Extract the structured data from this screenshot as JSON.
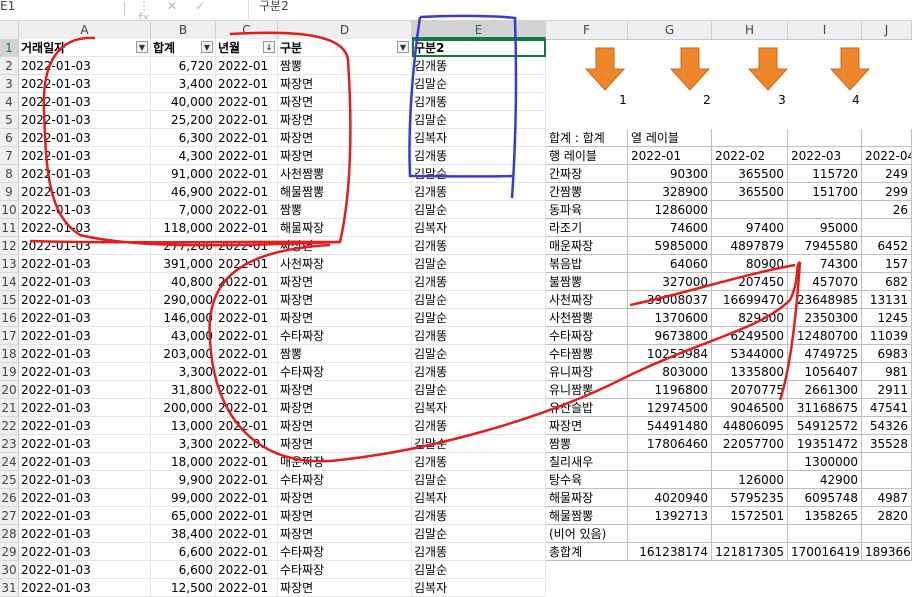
{
  "formula_bar": {
    "name_box": "E1",
    "buttons": [
      "⋮",
      "✕",
      "✓",
      "fx"
    ],
    "content": "구분2"
  },
  "columns": [
    "A",
    "B",
    "C",
    "D",
    "E",
    "F",
    "G",
    "H",
    "I",
    "J"
  ],
  "headers": {
    "a": "거래일자",
    "b": "합계",
    "c": "년월",
    "d": "구분",
    "e": "구분2"
  },
  "rows": [
    {
      "n": "2",
      "a": "2022-01-03",
      "b": "6,720",
      "c": "2022-01",
      "d": "짬뽕",
      "e": "김개똥"
    },
    {
      "n": "3",
      "a": "2022-01-03",
      "b": "3,400",
      "c": "2022-01",
      "d": "짜장면",
      "e": "김말순"
    },
    {
      "n": "4",
      "a": "2022-01-03",
      "b": "40,000",
      "c": "2022-01",
      "d": "짜장면",
      "e": "김개똥"
    },
    {
      "n": "5",
      "a": "2022-01-03",
      "b": "25,200",
      "c": "2022-01",
      "d": "짜장면",
      "e": "김말순"
    },
    {
      "n": "6",
      "a": "2022-01-03",
      "b": "6,300",
      "c": "2022-01",
      "d": "짜장면",
      "e": "김복자"
    },
    {
      "n": "7",
      "a": "2022-01-03",
      "b": "4,300",
      "c": "2022-01",
      "d": "짜장면",
      "e": "김개똥"
    },
    {
      "n": "8",
      "a": "2022-01-03",
      "b": "91,000",
      "c": "2022-01",
      "d": "사천짬뽕",
      "e": "김말순"
    },
    {
      "n": "9",
      "a": "2022-01-03",
      "b": "46,900",
      "c": "2022-01",
      "d": "해물짬뽕",
      "e": "김개똥"
    },
    {
      "n": "10",
      "a": "2022-01-03",
      "b": "7,000",
      "c": "2022-01",
      "d": "짬뽕",
      "e": "김말순"
    },
    {
      "n": "11",
      "a": "2022-01-03",
      "b": "118,000",
      "c": "2022-01",
      "d": "해물짜장",
      "e": "김복자"
    },
    {
      "n": "12",
      "a": "2022-01-03",
      "b": "277,200",
      "c": "2022-01",
      "d": "짜장면",
      "e": "김개똥"
    },
    {
      "n": "13",
      "a": "2022-01-03",
      "b": "391,000",
      "c": "2022-01",
      "d": "사천짜장",
      "e": "김말순"
    },
    {
      "n": "14",
      "a": "2022-01-03",
      "b": "40,800",
      "c": "2022-01",
      "d": "짜장면",
      "e": "김개똥"
    },
    {
      "n": "15",
      "a": "2022-01-03",
      "b": "290,000",
      "c": "2022-01",
      "d": "짜장면",
      "e": "김말순"
    },
    {
      "n": "16",
      "a": "2022-01-03",
      "b": "146,000",
      "c": "2022-01",
      "d": "짜장면",
      "e": "김말순"
    },
    {
      "n": "17",
      "a": "2022-01-03",
      "b": "43,000",
      "c": "2022-01",
      "d": "수타짜장",
      "e": "김개똥"
    },
    {
      "n": "18",
      "a": "2022-01-03",
      "b": "203,000",
      "c": "2022-01",
      "d": "짬뽕",
      "e": "김말순"
    },
    {
      "n": "19",
      "a": "2022-01-03",
      "b": "3,300",
      "c": "2022-01",
      "d": "수타짜장",
      "e": "김개똥"
    },
    {
      "n": "20",
      "a": "2022-01-03",
      "b": "31,800",
      "c": "2022-01",
      "d": "짜장면",
      "e": "김말순"
    },
    {
      "n": "21",
      "a": "2022-01-03",
      "b": "200,000",
      "c": "2022-01",
      "d": "짜장면",
      "e": "김복자"
    },
    {
      "n": "22",
      "a": "2022-01-03",
      "b": "13,000",
      "c": "2022-01",
      "d": "짜장면",
      "e": "김개똥"
    },
    {
      "n": "23",
      "a": "2022-01-03",
      "b": "3,300",
      "c": "2022-01",
      "d": "짜장면",
      "e": "김말순"
    },
    {
      "n": "24",
      "a": "2022-01-03",
      "b": "18,000",
      "c": "2022-01",
      "d": "매운짜장",
      "e": "김개똥"
    },
    {
      "n": "25",
      "a": "2022-01-03",
      "b": "9,900",
      "c": "2022-01",
      "d": "수타짜장",
      "e": "김말순"
    },
    {
      "n": "26",
      "a": "2022-01-03",
      "b": "99,000",
      "c": "2022-01",
      "d": "짜장면",
      "e": "김복자"
    },
    {
      "n": "27",
      "a": "2022-01-03",
      "b": "65,000",
      "c": "2022-01",
      "d": "짜장면",
      "e": "김개똥"
    },
    {
      "n": "28",
      "a": "2022-01-03",
      "b": "38,400",
      "c": "2022-01",
      "d": "짜장면",
      "e": "김말순"
    },
    {
      "n": "29",
      "a": "2022-01-03",
      "b": "6,600",
      "c": "2022-01",
      "d": "수타짜장",
      "e": "김개똥"
    },
    {
      "n": "30",
      "a": "2022-01-03",
      "b": "6,600",
      "c": "2022-01",
      "d": "수타짜장",
      "e": "김말순"
    },
    {
      "n": "31",
      "a": "2022-01-03",
      "b": "12,500",
      "c": "2022-01",
      "d": "짜장면",
      "e": "김복자"
    }
  ],
  "arrows": {
    "labels": [
      "1",
      "2",
      "3",
      "4"
    ],
    "color": "#f0862b"
  },
  "pivot": {
    "sum_label": "합계 : 합계",
    "col_label": "열 레이블",
    "row_label": "행 레이블",
    "months": [
      "2022-01",
      "2022-02",
      "2022-03",
      "2022-04"
    ],
    "rows": [
      {
        "name": "간짜장",
        "v": [
          "90300",
          "365500",
          "115720",
          "249"
        ]
      },
      {
        "name": "간짬뽕",
        "v": [
          "328900",
          "365500",
          "151700",
          "299"
        ]
      },
      {
        "name": "동파육",
        "v": [
          "1286000",
          "",
          "",
          "26"
        ]
      },
      {
        "name": "라조기",
        "v": [
          "74600",
          "97400",
          "95000",
          ""
        ]
      },
      {
        "name": "매운짜장",
        "v": [
          "5985000",
          "4897879",
          "7945580",
          "6452"
        ]
      },
      {
        "name": "볶음밥",
        "v": [
          "64060",
          "80900",
          "74300",
          "157"
        ]
      },
      {
        "name": "불짬뽕",
        "v": [
          "327000",
          "207450",
          "457070",
          "682"
        ]
      },
      {
        "name": "사천짜장",
        "v": [
          "39008037",
          "16699470",
          "23648985",
          "13131"
        ]
      },
      {
        "name": "사천짬뽕",
        "v": [
          "1370600",
          "829300",
          "2350300",
          "1245"
        ]
      },
      {
        "name": "수타짜장",
        "v": [
          "9673800",
          "6249500",
          "12480700",
          "11039"
        ]
      },
      {
        "name": "수타짬뽕",
        "v": [
          "10253984",
          "5344000",
          "4749725",
          "6983"
        ]
      },
      {
        "name": "유니짜장",
        "v": [
          "803000",
          "1335800",
          "1056407",
          "981"
        ]
      },
      {
        "name": "유니짬뽕",
        "v": [
          "1196800",
          "2070775",
          "2661300",
          "2911"
        ]
      },
      {
        "name": "유산슬밥",
        "v": [
          "12974500",
          "9046500",
          "31168675",
          "47541"
        ]
      },
      {
        "name": "짜장면",
        "v": [
          "54491480",
          "44806095",
          "54912572",
          "54326"
        ]
      },
      {
        "name": "짬뽕",
        "v": [
          "17806460",
          "22057700",
          "19351472",
          "35528"
        ]
      },
      {
        "name": "칠리새우",
        "v": [
          "",
          "",
          "1300000",
          ""
        ]
      },
      {
        "name": "탕수육",
        "v": [
          "",
          "126000",
          "42900",
          ""
        ]
      },
      {
        "name": "해물짜장",
        "v": [
          "4020940",
          "5795235",
          "6095748",
          "4987"
        ]
      },
      {
        "name": "해물짬뽕",
        "v": [
          "1392713",
          "1572501",
          "1358265",
          "2820"
        ]
      },
      {
        "name": "(비어 있음)",
        "v": [
          "",
          "",
          "",
          ""
        ]
      }
    ],
    "total": {
      "name": "총합계",
      "v": [
        "161238174",
        "121817305",
        "170016419",
        "189366"
      ]
    }
  },
  "annotation_colors": {
    "red": "#e02020",
    "blue": "#3a3ad0"
  }
}
